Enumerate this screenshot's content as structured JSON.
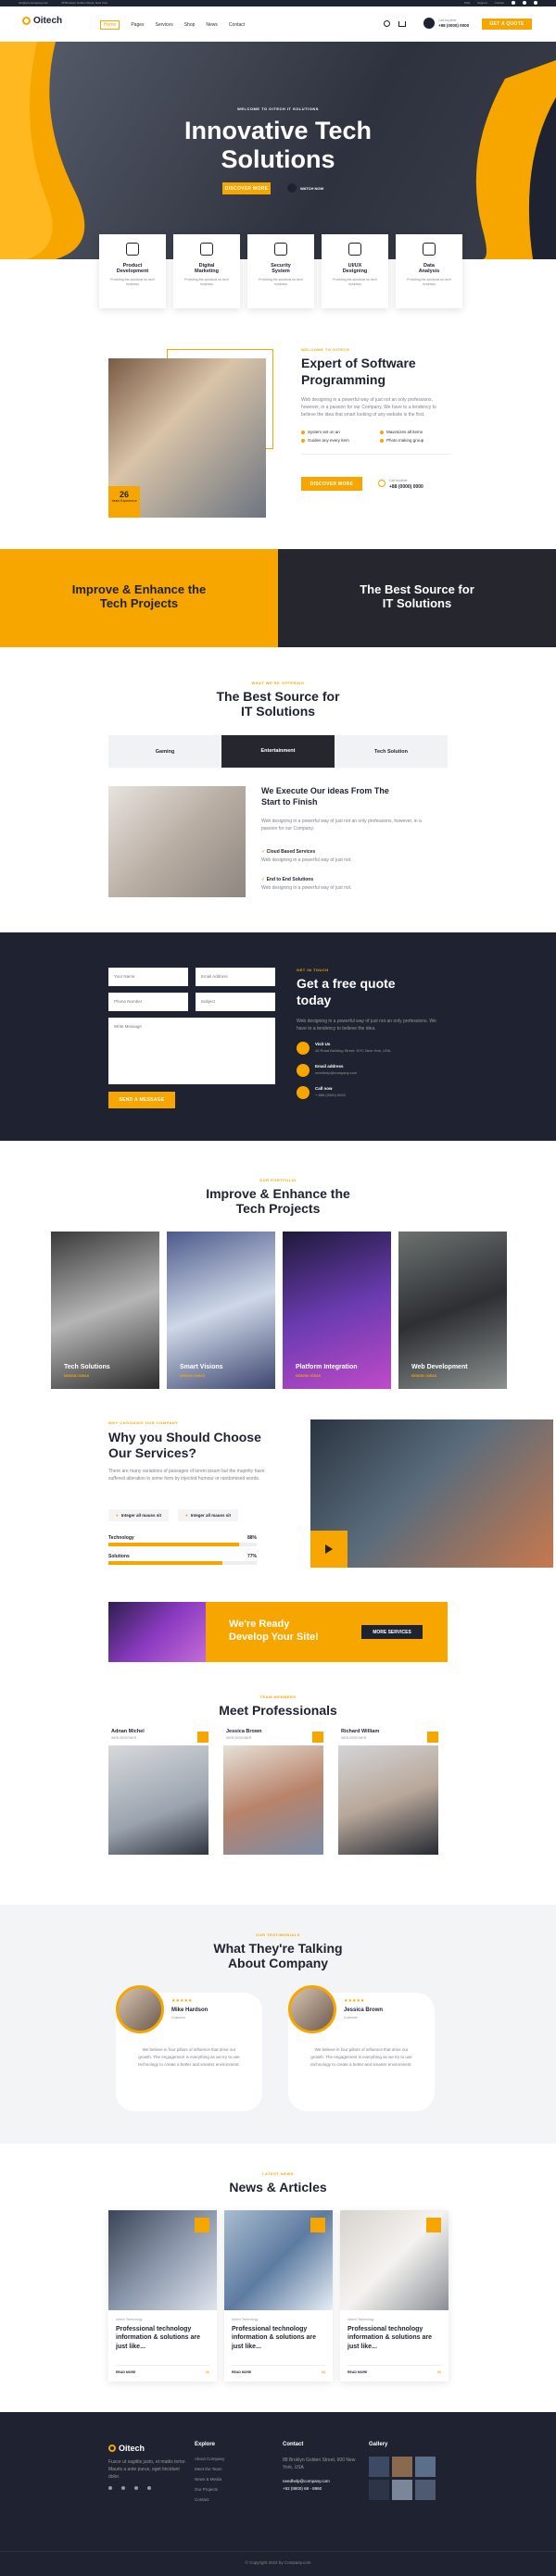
{
  "topbar": {
    "email": "info@yourcompany.com",
    "address": "45 Brooklyn Golden Street, New York",
    "links": [
      "FAQ",
      "Support",
      "Contact"
    ]
  },
  "nav": {
    "logo": "Oitech",
    "items": [
      "Home",
      "Pages",
      "Services",
      "Shop",
      "News",
      "Contact"
    ],
    "phone_label": "Call Anytime",
    "phone": "+88 (0000) 0000",
    "cta": "GET A QUOTE"
  },
  "hero": {
    "tag": "WELCOME TO OITECH IT SOLUTIONS",
    "title1": "Innovative Tech",
    "title2": "Solutions",
    "btn": "DISCOVER MORE",
    "video": "WATCH NOW"
  },
  "features": [
    {
      "t1": "Product",
      "t2": "Development",
      "d": "Providing the solutions for tech business"
    },
    {
      "t1": "Digital",
      "t2": "Marketing",
      "d": "Providing the solutions for tech business"
    },
    {
      "t1": "Security",
      "t2": "System",
      "d": "Providing the solutions for tech business"
    },
    {
      "t1": "UI/UX",
      "t2": "Designing",
      "d": "Providing the solutions for tech business"
    },
    {
      "t1": "Data",
      "t2": "Analysis",
      "d": "Providing the solutions for tech business"
    }
  ],
  "about": {
    "tag": "WELCOME TO OITECH",
    "title1": "Expert of Software",
    "title2": "Programming",
    "desc": "Web designing in a powerful way of just not an only professions, however, in a passion for our Company. We have to a tendency to believe the idea that smart looking of any website is the first.",
    "checks": [
      "System set on an",
      "Guides any every item",
      "Maximizes all items",
      "Photo making group"
    ],
    "btn": "DISCOVER MORE",
    "call_label": "Call Anytime",
    "call": "+88 (0000) 0000",
    "years": "26",
    "years_label": "Years Experience"
  },
  "banner": {
    "left1": "Improve & Enhance the",
    "left2": "Tech Projects",
    "right1": "The Best Source for",
    "right2": "IT Solutions"
  },
  "source": {
    "tag": "WHAT WE'RE OFFERING",
    "title1": "The Best Source for",
    "title2": "IT Solutions",
    "tabs": [
      "Gaming",
      "Entertainment",
      "Tech Solution"
    ],
    "sub1": "We Execute Our ideas From The",
    "sub2": "Start to Finish",
    "desc": "Web designing in a powerful way of just not an only professions, however, in a passion for our Company.",
    "items": [
      {
        "t": "Cloud Based Services",
        "d": "Web designing in a powerful way of just not."
      },
      {
        "t": "End to End Solutions",
        "d": "Web designing in a powerful way of just not."
      }
    ]
  },
  "quote": {
    "fields": [
      "Your Name",
      "Email Address",
      "Phone Number",
      "Subject",
      "Write Message"
    ],
    "btn": "SEND A MESSAGE",
    "tag": "GET IN TOUCH",
    "title1": "Get a free quote",
    "title2": "today",
    "desc": "Web designing in a powerful way of just not an only professions. We have to a tendency to believe the idea.",
    "contacts": [
      {
        "l": "Visit Us",
        "v": "45 Road Building Street, NYC New York, USA"
      },
      {
        "l": "Email address",
        "v": "needhelp@company.com"
      },
      {
        "l": "Call now",
        "v": "+ 888 (0000) 0000"
      }
    ]
  },
  "projects": {
    "tag": "OUR PORTFOLIO",
    "title1": "Improve & Enhance the",
    "title2": "Tech Projects",
    "cards": [
      {
        "t": "Tech Solutions",
        "c": "DESIGN / IDEAS"
      },
      {
        "t": "Smart Visions",
        "c": "DESIGN / IDEAS"
      },
      {
        "t": "Platform Integration",
        "c": "DESIGN / IDEAS"
      },
      {
        "t": "Web Development",
        "c": "DESIGN / IDEAS"
      }
    ]
  },
  "why": {
    "tag": "WHY CHOOSING OUR COMPANY",
    "title1": "Why you Should Choose",
    "title2": "Our Services?",
    "desc": "There are many variations of passages of lorem ipsum but the majority have suffered alteration in some form by injected humour or randomised words.",
    "checks": [
      "Integer all mauss sit",
      "Integer all mauss sit"
    ],
    "bars": [
      {
        "l": "Technology",
        "v": "88%",
        "n": 88
      },
      {
        "l": "Solutions",
        "v": "77%",
        "n": 77
      }
    ]
  },
  "ready": {
    "t1": "We're Ready",
    "t2": "Develop Your Site!",
    "btn": "MORE SERVICES"
  },
  "team": {
    "tag": "TEAM MEMBERS",
    "title": "Meet Professionals",
    "members": [
      {
        "n": "Adnan Michel",
        "r": "WEB DESIGNER"
      },
      {
        "n": "Jessica Brown",
        "r": "WEB DESIGNER"
      },
      {
        "n": "Richard William",
        "r": "WEB DESIGNER"
      }
    ]
  },
  "testi": {
    "tag": "OUR TESTIMONIALS",
    "title1": "What They're Talking",
    "title2": "About Company",
    "items": [
      {
        "n": "Mike Hardson",
        "r": "Customer",
        "stars": "★★★★★",
        "q": "We believe in four pillars of influence that drive our growth. The engagement is everything as we try to use technology to create a better and smarter environment."
      },
      {
        "n": "Jessica Brown",
        "r": "Customer",
        "stars": "★★★★★",
        "q": "We believe in four pillars of influence that drive our growth. The engagement is everything as we try to use technology to create a better and smarter environment."
      }
    ]
  },
  "news": {
    "tag": "LATEST NEWS",
    "title": "News & Articles",
    "posts": [
      {
        "meta": "Admin  Technology",
        "t": "Professional technology information & solutions are just like...",
        "more": "READ MORE",
        "c": "02"
      },
      {
        "meta": "Admin  Technology",
        "t": "Professional technology information & solutions are just like...",
        "more": "READ MORE",
        "c": "02"
      },
      {
        "meta": "Admin  Technology",
        "t": "Professional technology information & solutions are just like...",
        "more": "READ MORE",
        "c": "02"
      }
    ]
  },
  "footer": {
    "logo": "Oitech",
    "desc": "Fusce ut sagittis justo, et mattis tortor. Mauris a ante purus, eget tincidunt dolor.",
    "explore": {
      "h": "Explore",
      "items": [
        "About Company",
        "Meet the Team",
        "News & Media",
        "Our Projects",
        "Contact"
      ]
    },
    "contact": {
      "h": "Contact",
      "addr": "88 Broklyn Golden Street, 600 New York, USA",
      "email": "needhelp@company.com",
      "phone": "+92 (8800) 68 - 8960"
    },
    "gallery": {
      "h": "Gallery"
    },
    "copy": "© Copyright 2022 by Company.com"
  }
}
